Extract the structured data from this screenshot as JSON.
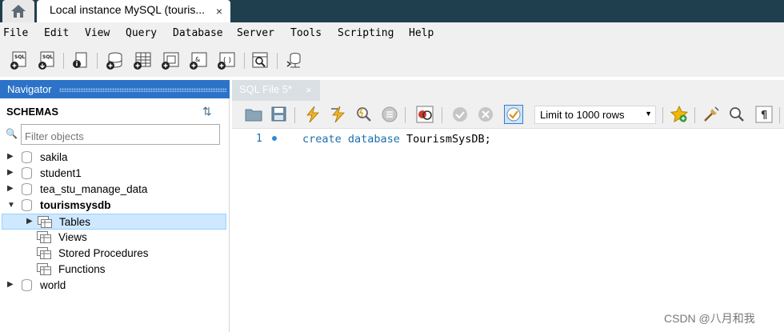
{
  "window": {
    "tab_title": "Local instance MySQL (touris...",
    "tab_close": "×"
  },
  "menu": [
    "File",
    "Edit",
    "View",
    "Query",
    "Database",
    "Server",
    "Tools",
    "Scripting",
    "Help"
  ],
  "navigator": {
    "title": "Navigator",
    "section": "SCHEMAS",
    "filter_placeholder": "Filter objects",
    "schemas": [
      {
        "name": "sakila",
        "expanded": false
      },
      {
        "name": "student1",
        "expanded": false
      },
      {
        "name": "tea_stu_manage_data",
        "expanded": false
      },
      {
        "name": "tourismsysdb",
        "expanded": true,
        "bold": true
      },
      {
        "name": "world",
        "expanded": false
      }
    ],
    "children": [
      {
        "name": "Tables",
        "selected": true
      },
      {
        "name": "Views"
      },
      {
        "name": "Stored Procedures"
      },
      {
        "name": "Functions"
      }
    ]
  },
  "editor": {
    "tab_label": "SQL File 5*",
    "tab_close": "×",
    "limit_label": "Limit to 1000 rows",
    "line_number": "1",
    "code_keywords": "create database",
    "code_rest": " TourismSysDB;"
  },
  "watermark": "CSDN @八月和我",
  "colors": {
    "titlebar": "#1f3f4f",
    "navigator_header": "#2c73c8",
    "selection": "#cde8ff",
    "keyword": "#1a6fb0"
  }
}
